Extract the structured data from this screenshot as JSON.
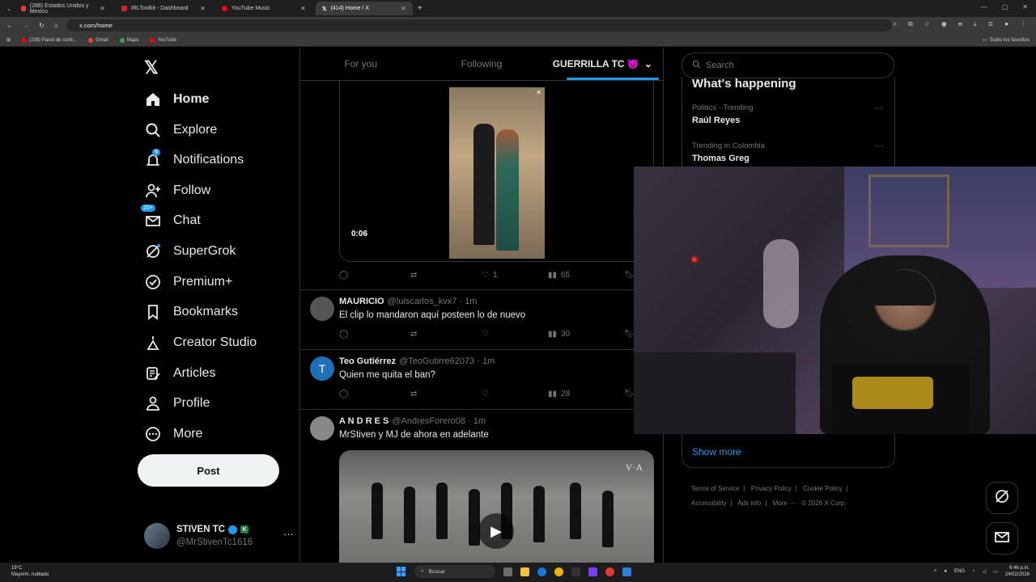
{
  "browser": {
    "tabs": [
      {
        "label": "(288) Estados Unidos y Mexico",
        "color": "#e53935"
      },
      {
        "label": "IRLToolkit - Dashboard",
        "color": "#c62828"
      },
      {
        "label": "YouTube Music",
        "color": "#ff0000"
      },
      {
        "label": "(414) Home / X",
        "color": "#ffffff"
      }
    ],
    "url": "x.com/home",
    "bookmarks": [
      {
        "label": "(238) Panel de contr...",
        "color": "#ff0000"
      },
      {
        "label": "Gmail",
        "color": "#ea4335"
      },
      {
        "label": "Maps",
        "color": "#34a853"
      },
      {
        "label": "YouTube",
        "color": "#ff0000"
      }
    ],
    "bookmarks_right": "Todos los favoritos"
  },
  "nav": {
    "items": [
      {
        "label": "Home",
        "icon": "home-icon"
      },
      {
        "label": "Explore",
        "icon": "search-icon"
      },
      {
        "label": "Notifications",
        "icon": "bell-icon",
        "badge": "9"
      },
      {
        "label": "Follow",
        "icon": "person-add-icon"
      },
      {
        "label": "Chat",
        "icon": "mail-icon",
        "badge": "20+"
      },
      {
        "label": "SuperGrok",
        "icon": "grok-icon"
      },
      {
        "label": "Premium+",
        "icon": "verified-icon"
      },
      {
        "label": "Bookmarks",
        "icon": "bookmark-icon"
      },
      {
        "label": "Creator Studio",
        "icon": "creator-icon"
      },
      {
        "label": "Articles",
        "icon": "article-icon"
      },
      {
        "label": "Profile",
        "icon": "profile-icon"
      },
      {
        "label": "More",
        "icon": "more-icon"
      }
    ],
    "post": "Post",
    "account": {
      "name": "STIVEN TC",
      "handle": "@MrStivenTc1616",
      "k": "K"
    }
  },
  "timeline": {
    "tabs": [
      "For you",
      "Following",
      "GUERRILLA TC 👿"
    ],
    "media_duration": "0:06",
    "first_actions": {
      "likes": "1",
      "views": "65"
    },
    "tweets": [
      {
        "name": "MAURICIO",
        "meta": "@luiscarlos_kvx7 · 1m",
        "text": "El clip lo mandaron aquí posteen lo de nuevo",
        "views": "30",
        "avatar": "#555"
      },
      {
        "name": "Teo Gutiérrez",
        "meta": "@TeoGutirre62073 · 1m",
        "text": "Quien me quita el ban?",
        "views": "28",
        "avatar": "#1d6fb8",
        "initial": "T"
      },
      {
        "name": "A N D R E S",
        "meta": "@AndresForero08 · 1m",
        "text": "MrStiven y MJ de ahora en adelante",
        "avatar": "#888"
      }
    ],
    "video_watermark": "V·A"
  },
  "right": {
    "search_placeholder": "Search",
    "happening_title": "What's happening",
    "trends": [
      {
        "context": "Politics · Trending",
        "name": "Raúl Reyes"
      },
      {
        "context": "Trending in Colombia",
        "name": "Thomas Greg"
      }
    ],
    "show_more": "Show more",
    "footer": [
      "Terms of Service",
      "|",
      "Privacy Policy",
      "|",
      "Cookie Policy",
      "|",
      "Accessibility",
      "|",
      "Ads info",
      "|",
      "More ···",
      "© 2026 X Corp."
    ]
  },
  "taskbar": {
    "temp": "19°C",
    "weather": "Mayorm. nublado",
    "search": "Buscar",
    "lang": "ENG",
    "time": "6:46 p.m.",
    "date": "24/02/2026"
  }
}
